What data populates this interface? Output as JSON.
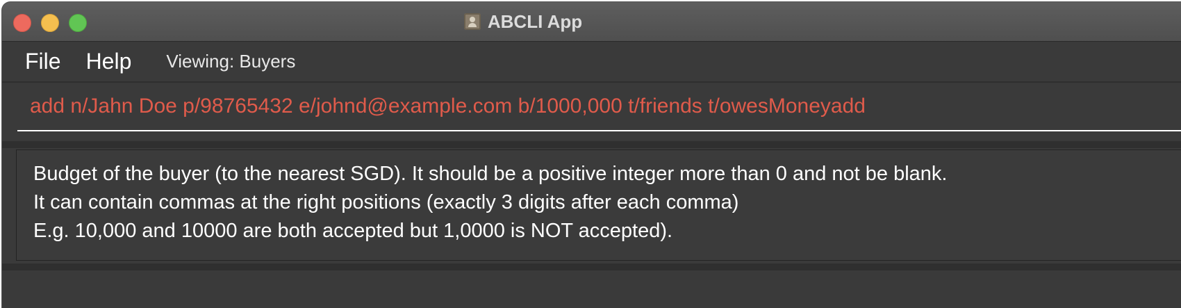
{
  "window": {
    "title": "ABCLI App"
  },
  "menu": {
    "file_label": "File",
    "help_label": "Help",
    "viewing_text": "Viewing: Buyers"
  },
  "command": {
    "value": "add n/Jahn Doe p/98765432 e/johnd@example.com b/1000,000 t/friends t/owesMoneyadd",
    "text_color": "#e05b4b"
  },
  "result": {
    "lines": [
      "Budget of the buyer (to the nearest SGD). It should be a positive integer more than 0 and not be blank.",
      "It can contain commas at the right positions (exactly 3 digits after each comma)",
      "E.g. 10,000 and 10000 are both accepted but 1,0000 is NOT accepted)."
    ]
  },
  "icons": {
    "app_icon": "person-card-icon"
  }
}
